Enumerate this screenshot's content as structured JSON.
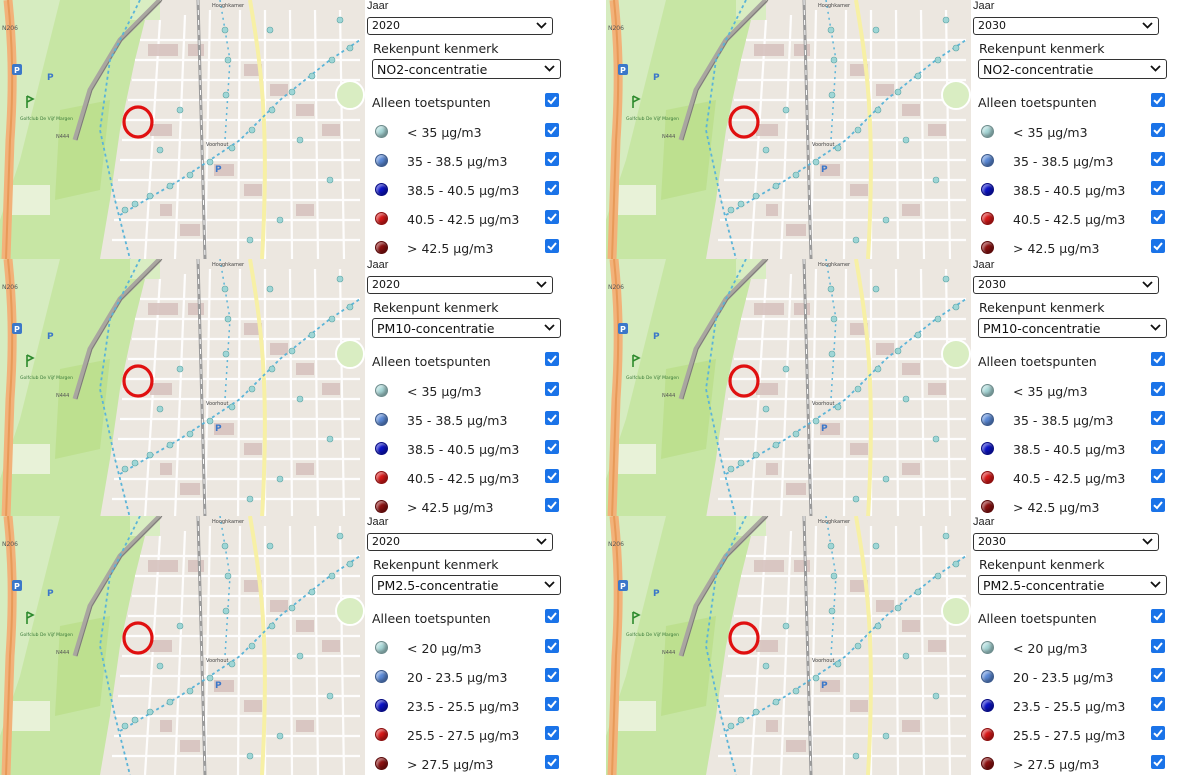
{
  "panels": [
    {
      "jaar_label": "Jaar",
      "year": "2020",
      "kenmerk_label": "Rekenpunt kenmerk",
      "kenmerk": "NO2-concentratie",
      "toetspunten_label": "Alleen toetspunten",
      "toetspunten_checked": true,
      "classes": [
        {
          "label": "< 35 µg/m3",
          "color": "#a8d8d8",
          "checked": true
        },
        {
          "label": "35 - 38.5 µg/m3",
          "color": "#5b8ad8",
          "checked": true
        },
        {
          "label": "38.5 - 40.5 µg/m3",
          "color": "#0b12c8",
          "checked": true
        },
        {
          "label": "40.5 - 42.5 µg/m3",
          "color": "#d81818",
          "checked": true
        },
        {
          "label": "> 42.5 µg/m3",
          "color": "#8c1010",
          "checked": true
        }
      ]
    },
    {
      "jaar_label": "Jaar",
      "year": "2030",
      "kenmerk_label": "Rekenpunt kenmerk",
      "kenmerk": "NO2-concentratie",
      "toetspunten_label": "Alleen toetspunten",
      "toetspunten_checked": true,
      "classes": [
        {
          "label": "< 35 µg/m3",
          "color": "#a8d8d8",
          "checked": true
        },
        {
          "label": "35 - 38.5 µg/m3",
          "color": "#5b8ad8",
          "checked": true
        },
        {
          "label": "38.5 - 40.5 µg/m3",
          "color": "#0b12c8",
          "checked": true
        },
        {
          "label": "40.5 - 42.5 µg/m3",
          "color": "#d81818",
          "checked": true
        },
        {
          "label": "> 42.5 µg/m3",
          "color": "#8c1010",
          "checked": true
        }
      ]
    },
    {
      "jaar_label": "Jaar",
      "year": "2020",
      "kenmerk_label": "Rekenpunt kenmerk",
      "kenmerk": "PM10-concentratie",
      "toetspunten_label": "Alleen toetspunten",
      "toetspunten_checked": true,
      "classes": [
        {
          "label": "< 35 µg/m3",
          "color": "#a8d8d8",
          "checked": true
        },
        {
          "label": "35 - 38.5 µg/m3",
          "color": "#5b8ad8",
          "checked": true
        },
        {
          "label": "38.5 - 40.5 µg/m3",
          "color": "#0b12c8",
          "checked": true
        },
        {
          "label": "40.5 - 42.5 µg/m3",
          "color": "#d81818",
          "checked": true
        },
        {
          "label": "> 42.5 µg/m3",
          "color": "#8c1010",
          "checked": true
        }
      ]
    },
    {
      "jaar_label": "Jaar",
      "year": "2030",
      "kenmerk_label": "Rekenpunt kenmerk",
      "kenmerk": "PM10-concentratie",
      "toetspunten_label": "Alleen toetspunten",
      "toetspunten_checked": true,
      "classes": [
        {
          "label": "< 35 µg/m3",
          "color": "#a8d8d8",
          "checked": true
        },
        {
          "label": "35 - 38.5 µg/m3",
          "color": "#5b8ad8",
          "checked": true
        },
        {
          "label": "38.5 - 40.5 µg/m3",
          "color": "#0b12c8",
          "checked": true
        },
        {
          "label": "40.5 - 42.5 µg/m3",
          "color": "#d81818",
          "checked": true
        },
        {
          "label": "> 42.5 µg/m3",
          "color": "#8c1010",
          "checked": true
        }
      ]
    },
    {
      "jaar_label": "Jaar",
      "year": "2020",
      "kenmerk_label": "Rekenpunt kenmerk",
      "kenmerk": "PM2.5-concentratie",
      "toetspunten_label": "Alleen toetspunten",
      "toetspunten_checked": true,
      "classes": [
        {
          "label": "< 20 µg/m3",
          "color": "#a8d8d8",
          "checked": true
        },
        {
          "label": "20 - 23.5 µg/m3",
          "color": "#5b8ad8",
          "checked": true
        },
        {
          "label": "23.5 - 25.5 µg/m3",
          "color": "#0b12c8",
          "checked": true
        },
        {
          "label": "25.5 - 27.5 µg/m3",
          "color": "#d81818",
          "checked": true
        },
        {
          "label": "> 27.5 µg/m3",
          "color": "#8c1010",
          "checked": true
        }
      ]
    },
    {
      "jaar_label": "Jaar",
      "year": "2030",
      "kenmerk_label": "Rekenpunt kenmerk",
      "kenmerk": "PM2.5-concentratie",
      "toetspunten_label": "Alleen toetspunten",
      "toetspunten_checked": true,
      "classes": [
        {
          "label": "< 20 µg/m3",
          "color": "#a8d8d8",
          "checked": true
        },
        {
          "label": "20 - 23.5 µg/m3",
          "color": "#5b8ad8",
          "checked": true
        },
        {
          "label": "23.5 - 25.5 µg/m3",
          "color": "#0b12c8",
          "checked": true
        },
        {
          "label": "25.5 - 27.5 µg/m3",
          "color": "#d81818",
          "checked": true
        },
        {
          "label": "> 27.5 µg/m3",
          "color": "#8c1010",
          "checked": true
        }
      ]
    }
  ],
  "map": {
    "road_labels": [
      "N206",
      "N444",
      "Voorhout",
      "Hooghkamer"
    ],
    "poi_labels": [
      "P",
      "Golfclub De Vijf Margen"
    ],
    "marker_color": "#e01010",
    "icons": [
      "parking-icon",
      "golf-icon",
      "location-marker-icon"
    ]
  }
}
